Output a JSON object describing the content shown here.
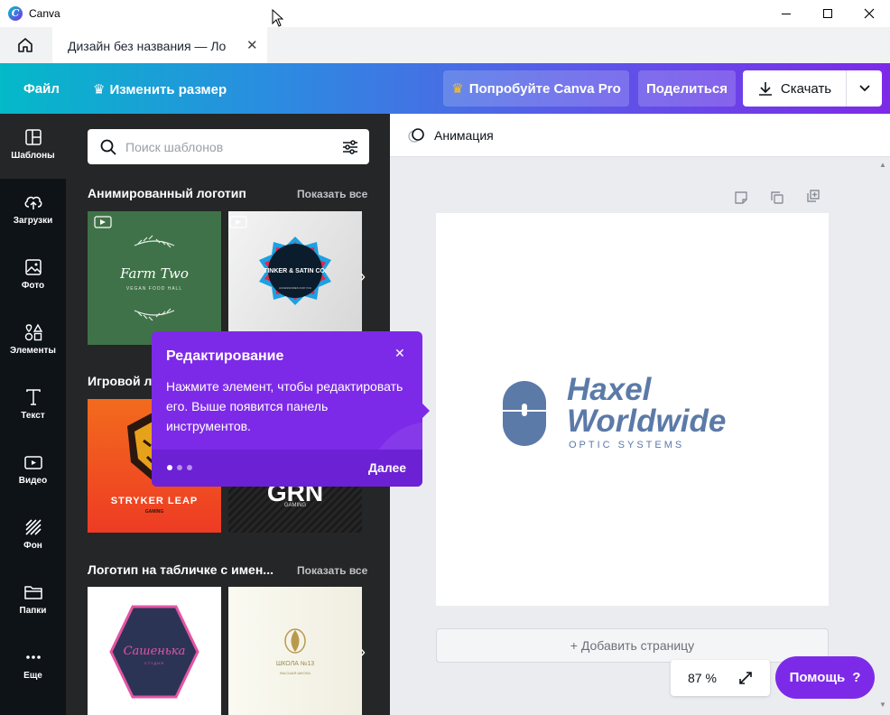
{
  "window": {
    "app_title": "Canva"
  },
  "tab": {
    "title": "Дизайн без названия — Ло"
  },
  "toolbar": {
    "file": "Файл",
    "resize": "Изменить размер",
    "try_pro": "Попробуйте Canva Pro",
    "share": "Поделиться",
    "download": "Скачать"
  },
  "sidebar": {
    "items": [
      {
        "label": "Шаблоны",
        "icon": "templates-icon"
      },
      {
        "label": "Загрузки",
        "icon": "upload-icon"
      },
      {
        "label": "Фото",
        "icon": "photo-icon"
      },
      {
        "label": "Элементы",
        "icon": "elements-icon"
      },
      {
        "label": "Текст",
        "icon": "text-icon"
      },
      {
        "label": "Видео",
        "icon": "video-icon"
      },
      {
        "label": "Фон",
        "icon": "background-icon"
      },
      {
        "label": "Папки",
        "icon": "folder-icon"
      },
      {
        "label": "Еще",
        "icon": "more-icon"
      }
    ]
  },
  "templates_panel": {
    "search_placeholder": "Поиск шаблонов",
    "sections": [
      {
        "title": "Анимированный логотип",
        "show_all": "Показать все",
        "templates": [
          {
            "name": "Farm Two",
            "subtitle": "VEGAN FOOD HALL"
          },
          {
            "name": "TINKER & SATIN CO.",
            "subtitle": "ACCESSORIES FOR YOU"
          }
        ]
      },
      {
        "title": "Игровой л",
        "templates": [
          {
            "name": "STRYKER LEAP",
            "subtitle": "GAMING"
          },
          {
            "name": "GRN",
            "subtitle": "GAMING"
          }
        ]
      },
      {
        "title": "Логотип на табличке с имен...",
        "show_all": "Показать все",
        "templates": [
          {
            "name": "Сашенька",
            "subtitle": "СТУДИЯ"
          },
          {
            "name": "ШКОЛА №13",
            "subtitle": "ВЫСШАЯ ШКОЛА"
          }
        ]
      }
    ]
  },
  "workspace": {
    "animation_label": "Анимация",
    "add_page": "+ Добавить страницу",
    "zoom": "87 %",
    "help": "Помощь",
    "help_icon": "?"
  },
  "design": {
    "line1": "Haxel",
    "line2": "Worldwide",
    "tagline": "OPTIC SYSTEMS",
    "color": "#5b7aa8"
  },
  "tooltip": {
    "title": "Редактирование",
    "body": "Нажмите элемент, чтобы редактировать его. Выше появится панель инструментов.",
    "next": "Далее"
  },
  "colors": {
    "accent": "#7d2ae8",
    "teal": "#00c4cc"
  }
}
